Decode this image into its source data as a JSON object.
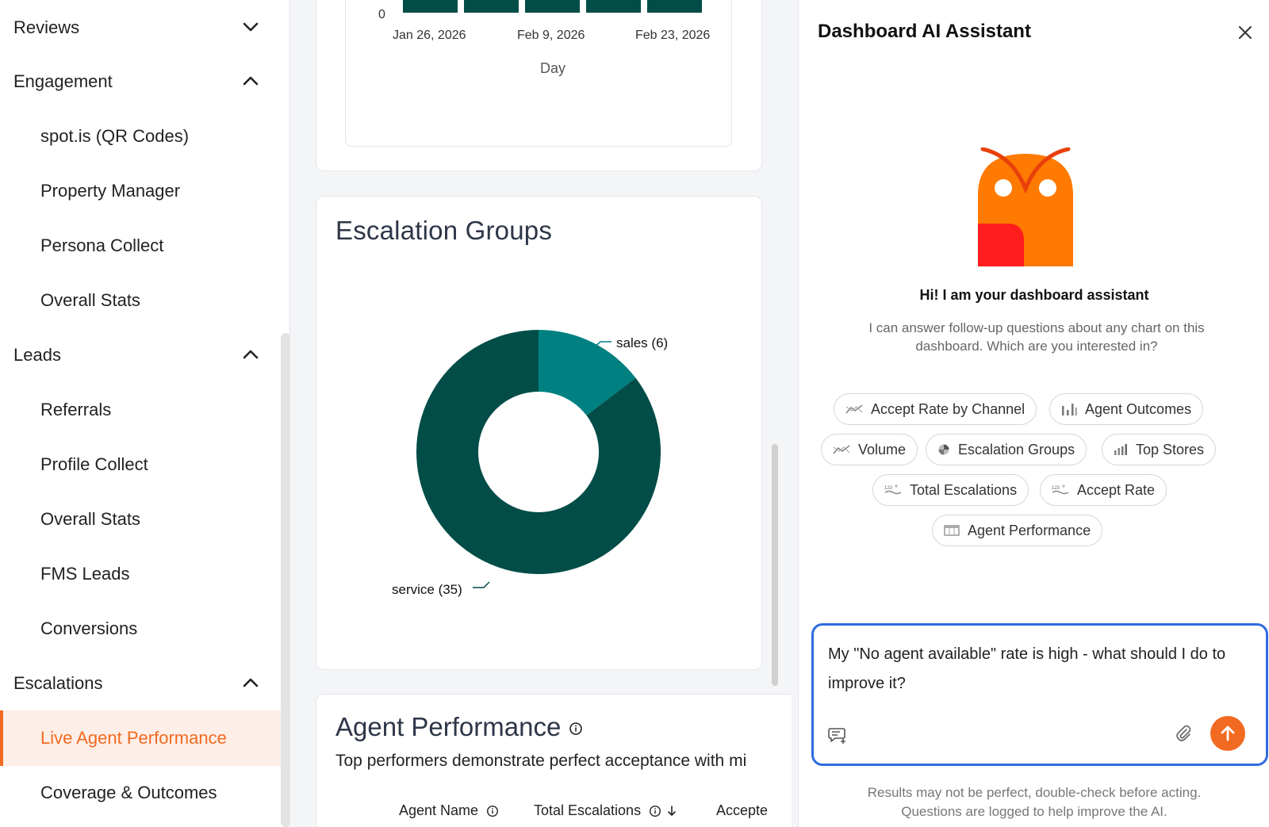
{
  "sidebar": {
    "groups": [
      {
        "label": "Reviews",
        "expanded": false
      },
      {
        "label": "Engagement",
        "expanded": true
      },
      {
        "label": "Leads",
        "expanded": true
      },
      {
        "label": "Escalations",
        "expanded": true
      }
    ],
    "engagement_items": [
      "spot.is (QR Codes)",
      "Property Manager",
      "Persona Collect",
      "Overall Stats"
    ],
    "leads_items": [
      "Referrals",
      "Profile Collect",
      "Overall Stats",
      "FMS Leads",
      "Conversions"
    ],
    "escalations_items": [
      "Live Agent Performance",
      "Coverage & Outcomes"
    ],
    "active_item": "Live Agent Performance"
  },
  "volume_chart": {
    "y_tick": "0",
    "x_ticks": [
      "Jan 26, 2026",
      "Feb 9, 2026",
      "Feb 23, 2026"
    ],
    "xlabel": "Day"
  },
  "escalation_groups": {
    "title": "Escalation Groups",
    "label_sales": "sales (6)",
    "label_service": "service (35)"
  },
  "chart_data": {
    "type": "pie",
    "title": "Escalation Groups",
    "slices": [
      {
        "label": "sales",
        "value": 6,
        "color": "#008080"
      },
      {
        "label": "service",
        "value": 35,
        "color": "#024d48"
      }
    ],
    "donut": true
  },
  "agent_performance": {
    "title": "Agent Performance",
    "subtitle": "Top performers demonstrate perfect acceptance with mi",
    "columns": [
      "Agent Name",
      "Total Escalations",
      "Accepte"
    ]
  },
  "ai_panel": {
    "title": "Dashboard AI Assistant",
    "greeting": "Hi! I am your dashboard assistant",
    "description": "I can answer follow-up questions about any chart on this dashboard. Which are you interested in?",
    "chips": [
      "Accept Rate by Channel",
      "Agent Outcomes",
      "Volume",
      "Escalation Groups",
      "Top Stores",
      "Total Escalations",
      "Accept Rate",
      "Agent Performance"
    ],
    "input_value": "My \"No agent available\" rate is high - what should I do to improve it?",
    "disclaimer_line1": "Results may not be perfect, double-check before acting.",
    "disclaimer_line2": "Questions are logged to help improve the AI."
  },
  "colors": {
    "accent": "#f26a21",
    "chart_dark": "#024d48",
    "chart_teal": "#008080",
    "input_border": "#2f6be0"
  }
}
